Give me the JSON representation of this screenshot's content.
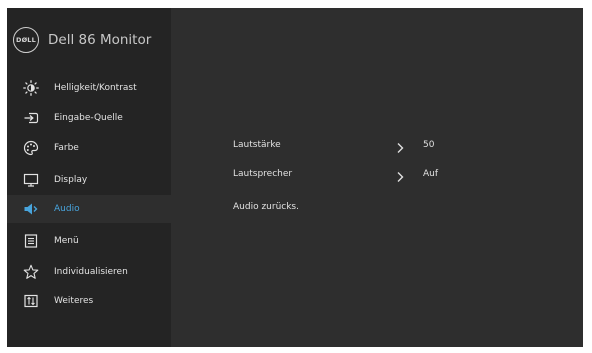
{
  "header": {
    "logo_text": "DØLL",
    "title": "Dell 86 Monitor"
  },
  "sidebar": {
    "active_index": 4,
    "items": [
      {
        "label": "Helligkeit/Kontrast",
        "icon": "brightness-icon"
      },
      {
        "label": "Eingabe-Quelle",
        "icon": "input-source-icon"
      },
      {
        "label": "Farbe",
        "icon": "color-palette-icon"
      },
      {
        "label": "Display",
        "icon": "display-icon"
      },
      {
        "label": "Audio",
        "icon": "speaker-icon"
      },
      {
        "label": "Menü",
        "icon": "menu-icon"
      },
      {
        "label": "Individualisieren",
        "icon": "star-icon"
      },
      {
        "label": "Weiteres",
        "icon": "others-icon"
      }
    ]
  },
  "audio_panel": {
    "rows": [
      {
        "label": "Lautstärke",
        "value": "50"
      },
      {
        "label": "Lautsprecher",
        "value": "Auf"
      },
      {
        "label": "Audio zurücks.",
        "value": ""
      }
    ]
  },
  "colors": {
    "sidebar_bg": "#242424",
    "panel_bg": "#2e2e2e",
    "accent": "#48a4dc",
    "text": "#e2e2e2"
  }
}
